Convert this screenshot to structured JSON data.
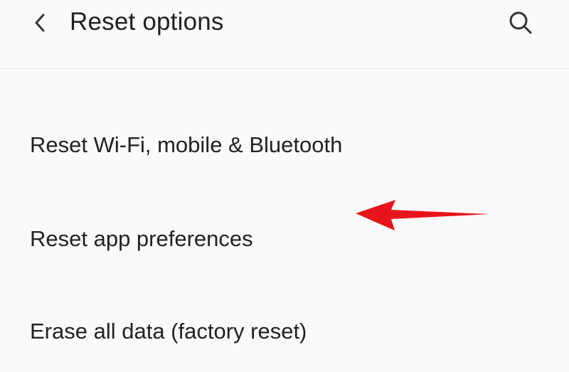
{
  "header": {
    "title": "Reset options",
    "back_icon": "chevron-left-icon",
    "search_icon": "search-icon"
  },
  "list": {
    "items": [
      {
        "label": "Reset Wi-Fi, mobile & Bluetooth"
      },
      {
        "label": "Reset app preferences"
      },
      {
        "label": "Erase all data (factory reset)"
      }
    ]
  },
  "annotation": {
    "arrow_color": "#e8141b",
    "target": "Reset Wi-Fi, mobile & Bluetooth"
  },
  "colors": {
    "background": "#fafafa",
    "text": "#222222",
    "divider": "#e6e6e6"
  }
}
